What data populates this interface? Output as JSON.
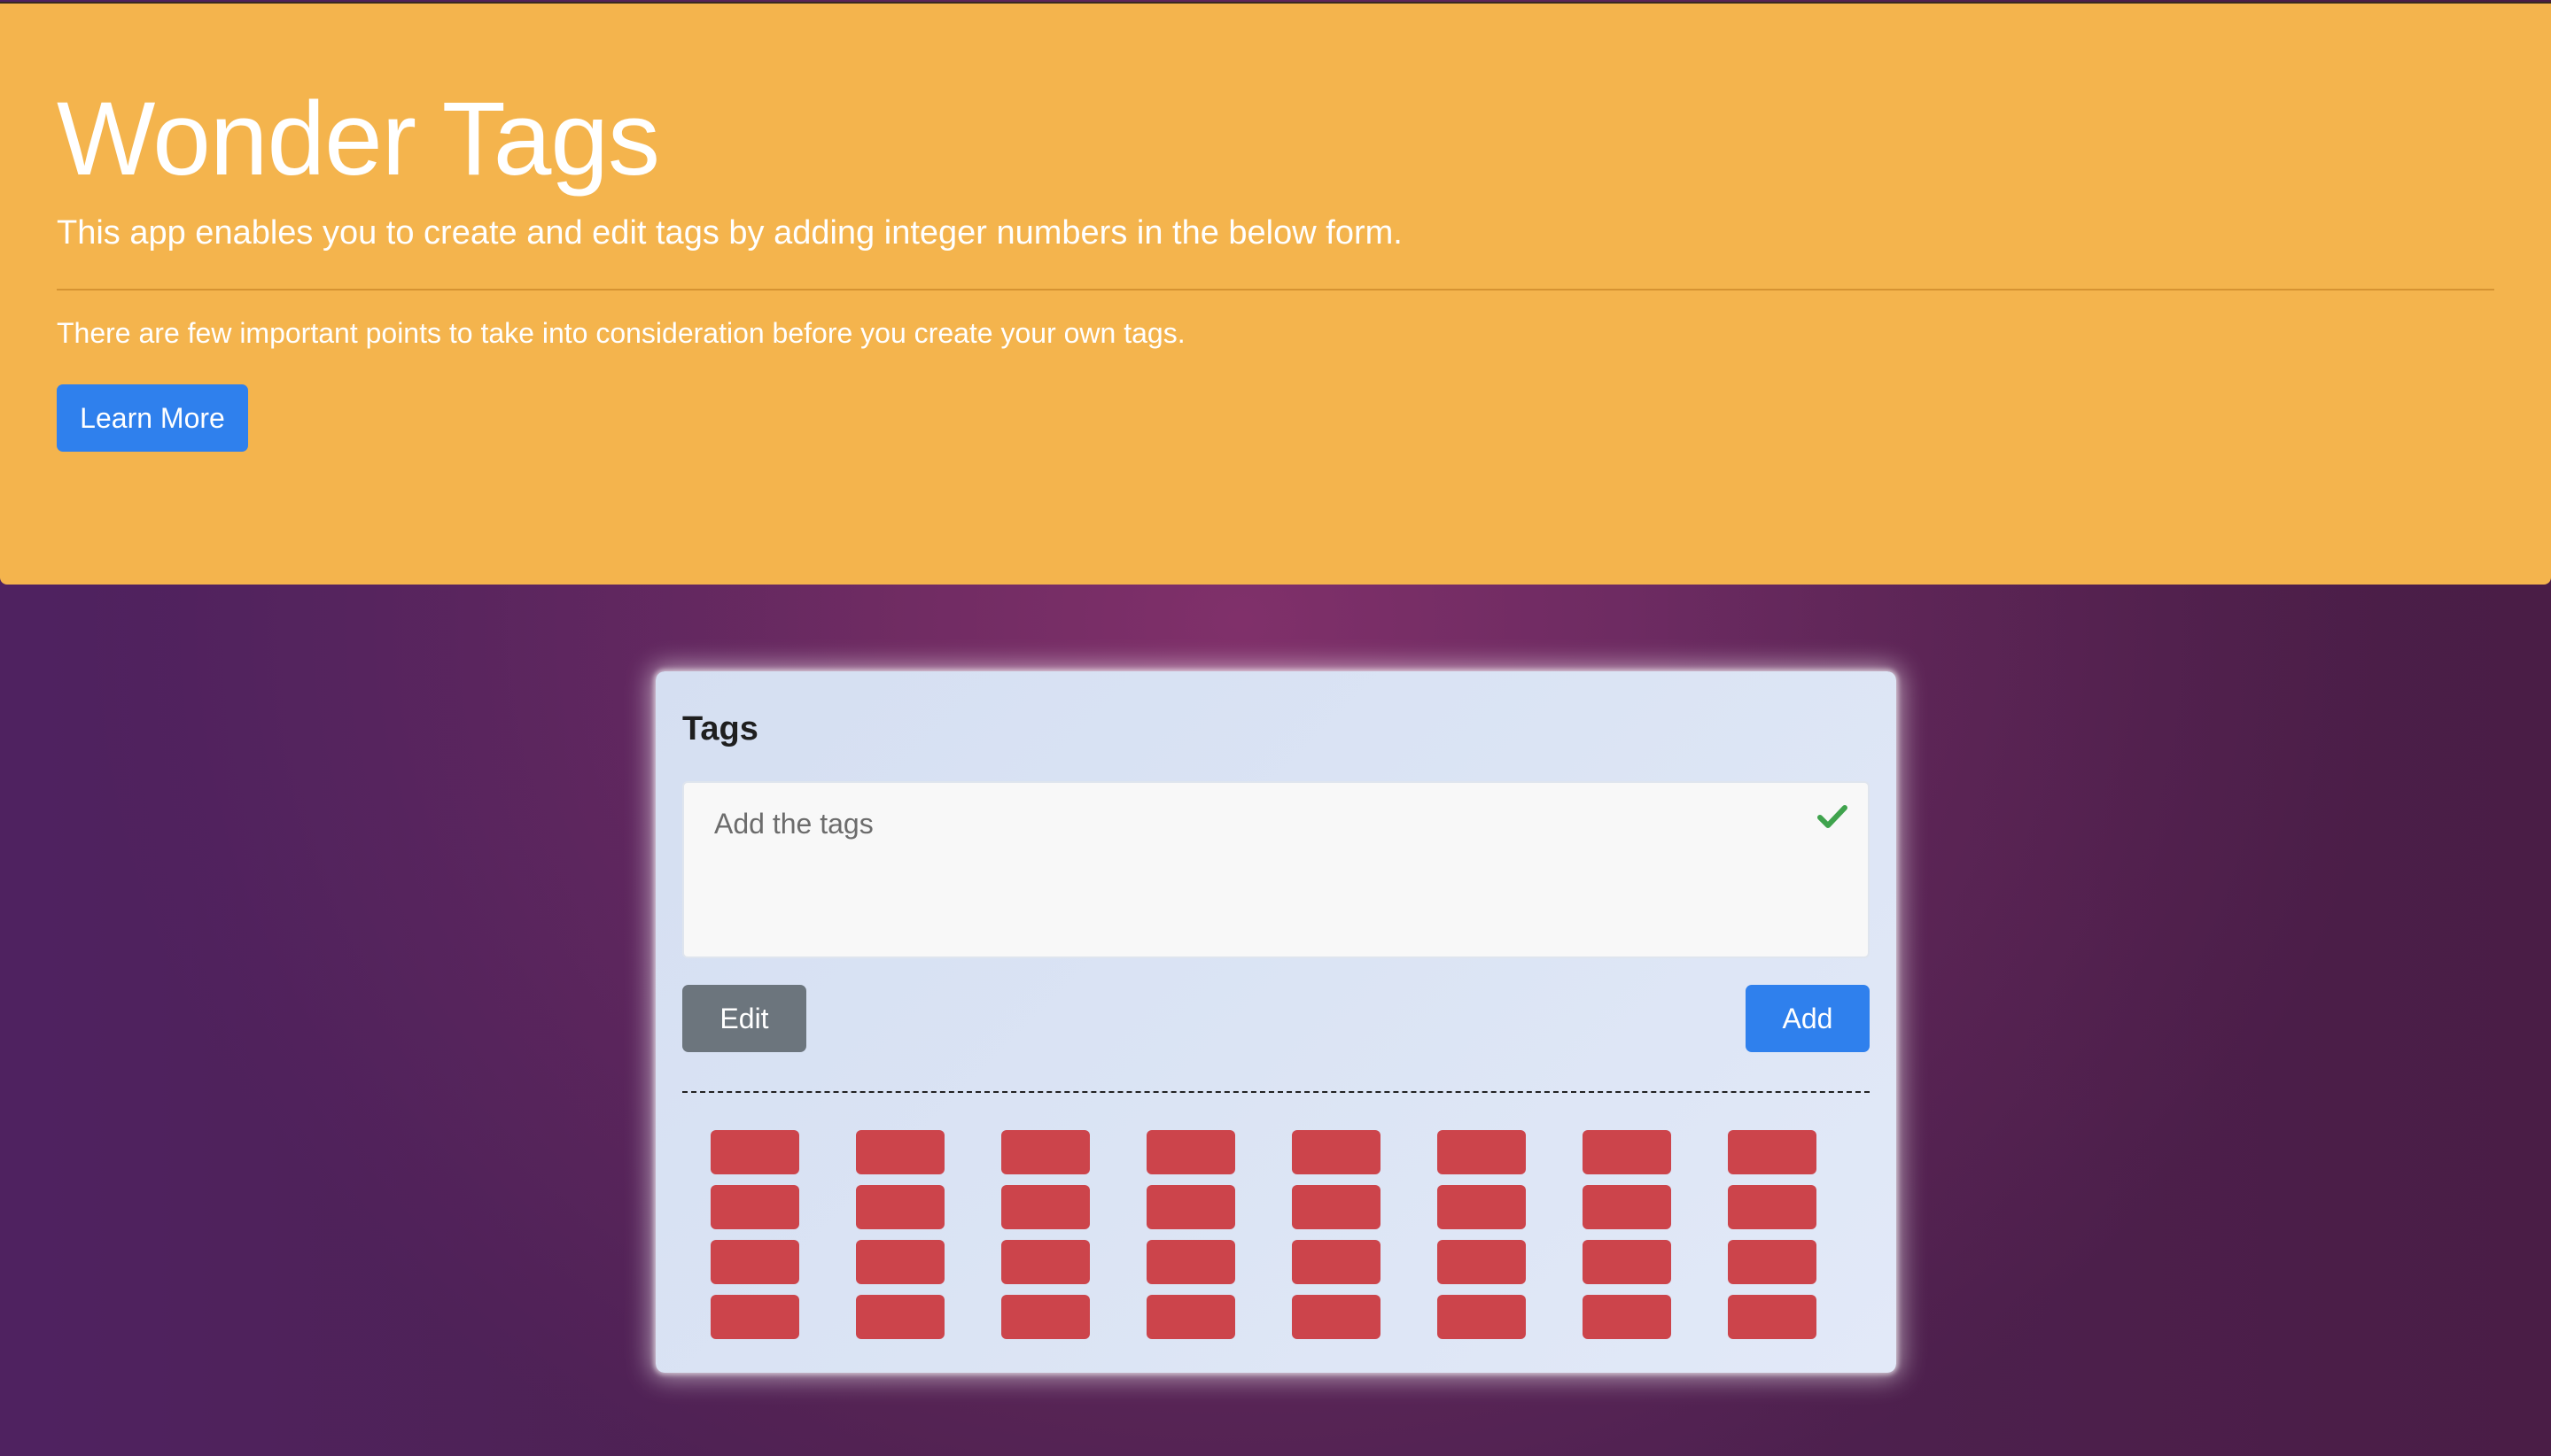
{
  "hero": {
    "title": "Wonder Tags",
    "lead": "This app enables you to create and edit tags by adding integer numbers in the below form.",
    "text": "There are few important points to take into consideration before you create your own tags.",
    "learn_more_label": "Learn More",
    "background_color": "#f4b44d"
  },
  "card": {
    "title": "Tags",
    "input": {
      "placeholder": "Add the tags",
      "value": "",
      "valid_icon": "check-icon"
    },
    "edit_label": "Edit",
    "add_label": "Add",
    "tags": {
      "rows": 4,
      "columns": 8,
      "color": "#cc444b"
    }
  },
  "colors": {
    "primary": "#2f80ed",
    "secondary": "#6c757d",
    "success": "#3fa34d"
  }
}
